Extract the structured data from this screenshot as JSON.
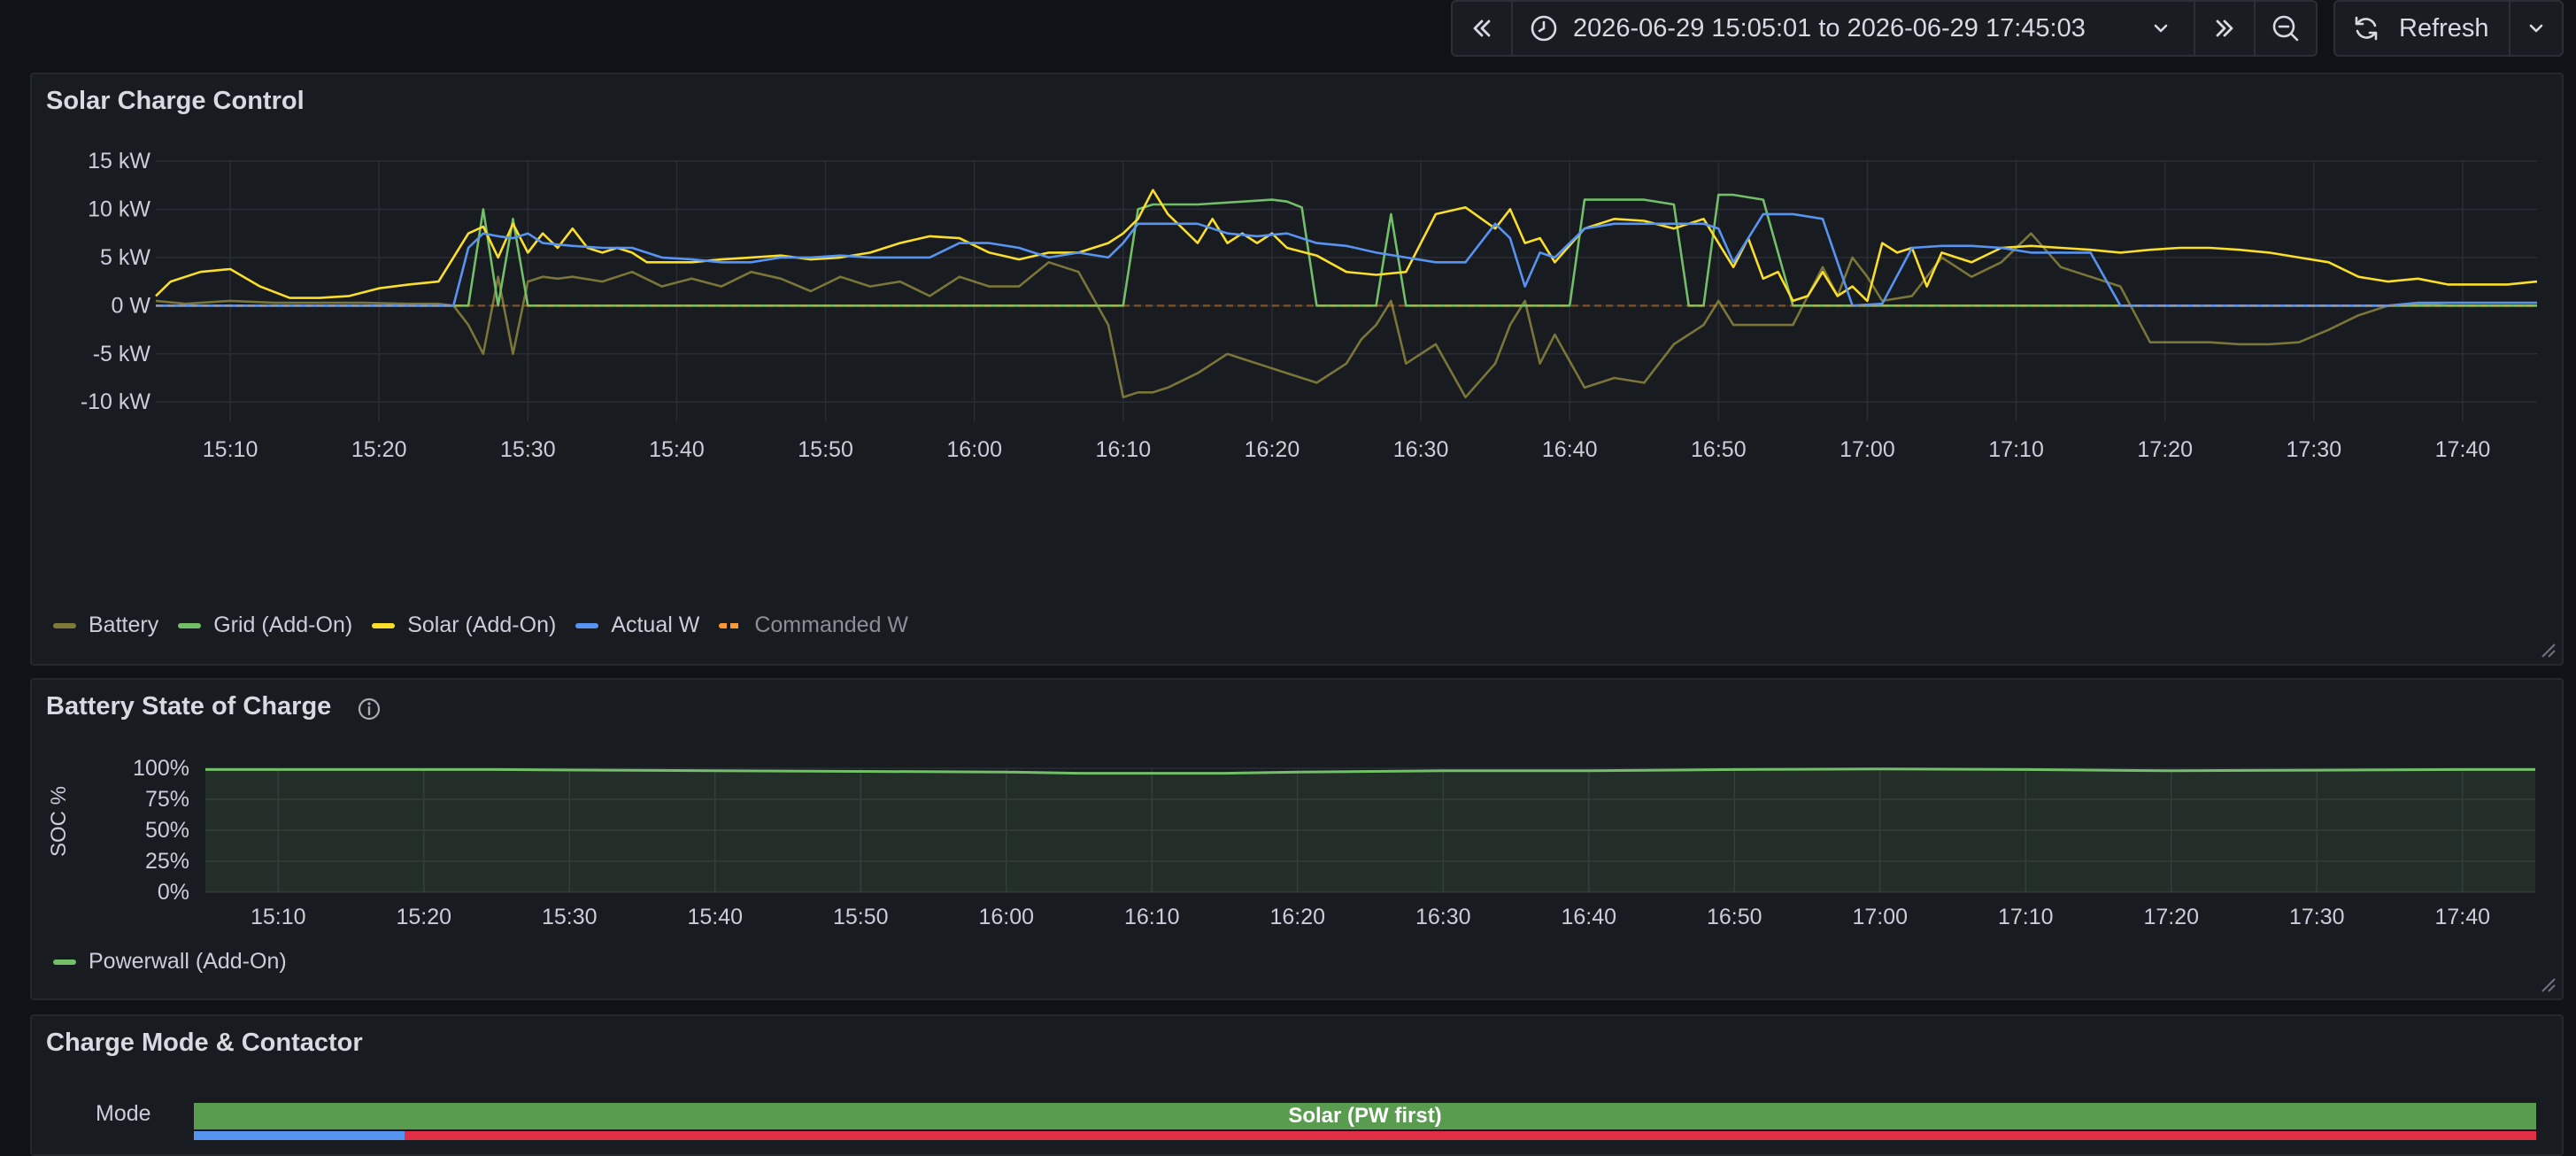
{
  "toolbar": {
    "time_range": "2026-06-29 15:05:01 to 2026-06-29 17:45:03",
    "refresh_label": "Refresh"
  },
  "colors": {
    "battery": "#807a3a",
    "grid": "#73bf69",
    "solar": "#fade2a",
    "actual": "#5794f2",
    "commanded": "#ff9830",
    "mode_bar": "#5a9c4f"
  },
  "panels": {
    "solar": {
      "title": "Solar Charge Control",
      "chart_data": {
        "type": "line",
        "y_ticks": [
          "15 kW",
          "10 kW",
          "5 kW",
          "0 W",
          "-5 kW",
          "-10 kW"
        ],
        "ylim": [
          -12,
          15
        ],
        "x_ticks": [
          "15:10",
          "15:20",
          "15:30",
          "15:40",
          "15:50",
          "16:00",
          "16:10",
          "16:20",
          "16:30",
          "16:40",
          "16:50",
          "17:00",
          "17:10",
          "17:20",
          "17:30",
          "17:40"
        ],
        "x_range_minutes": [
          0,
          160
        ],
        "x_tick_minutes": [
          5,
          15,
          25,
          35,
          45,
          55,
          65,
          75,
          85,
          95,
          105,
          115,
          125,
          135,
          145,
          155
        ],
        "legend": [
          {
            "name": "Battery",
            "color": "#807a3a"
          },
          {
            "name": "Grid (Add-On)",
            "color": "#73bf69"
          },
          {
            "name": "Solar (Add-On)",
            "color": "#fade2a"
          },
          {
            "name": "Actual W",
            "color": "#5794f2"
          },
          {
            "name": "Commanded W",
            "color": "#ff9830",
            "dashed": true,
            "dimmed": true
          }
        ],
        "series": [
          {
            "name": "Solar (Add-On)",
            "t": [
              0,
              1,
              3,
              5,
              7,
              9,
              11,
              13,
              15,
              17,
              19,
              21,
              22,
              23,
              24,
              25,
              26,
              27,
              28,
              29,
              30,
              31,
              32,
              33,
              34,
              36,
              38,
              40,
              42,
              44,
              46,
              48,
              50,
              52,
              54,
              56,
              58,
              60,
              62,
              64,
              65,
              66,
              67,
              68,
              69,
              70,
              71,
              72,
              73,
              74,
              75,
              76,
              78,
              80,
              82,
              84,
              86,
              88,
              90,
              91,
              92,
              93,
              94,
              96,
              98,
              100,
              102,
              104,
              105,
              106,
              107,
              108,
              109,
              110,
              111,
              112,
              113,
              114,
              115,
              116,
              117,
              118,
              119,
              120,
              121,
              122,
              124,
              126,
              128,
              130,
              132,
              134,
              136,
              138,
              140,
              142,
              144,
              146,
              148,
              150,
              152,
              154,
              156,
              158,
              160
            ],
            "v": [
              1,
              2.5,
              3.5,
              3.8,
              2,
              0.8,
              0.8,
              1,
              1.8,
              2.2,
              2.5,
              7.5,
              8.2,
              5,
              8.5,
              5.5,
              7.5,
              6,
              8,
              6,
              5.5,
              6,
              5.5,
              4.5,
              4.5,
              4.5,
              4.8,
              5,
              5.2,
              4.8,
              5,
              5.5,
              6.5,
              7.2,
              7,
              5.5,
              4.8,
              5.5,
              5.5,
              6.5,
              7.5,
              9,
              12,
              9.5,
              8,
              6.5,
              9,
              6.5,
              7.5,
              6.5,
              7.5,
              6,
              5.2,
              3.5,
              3.2,
              3.5,
              9.5,
              10.2,
              8,
              10,
              6.5,
              7,
              4.5,
              8,
              9,
              8.8,
              8,
              9,
              6.5,
              4,
              7,
              2.8,
              3.5,
              0.5,
              1,
              3.5,
              1,
              2,
              0.5,
              6.5,
              5.5,
              6,
              2,
              5.5,
              5,
              4.5,
              6,
              6.2,
              6,
              5.8,
              5.5,
              5.8,
              6,
              6,
              5.8,
              5.5,
              5,
              4.5,
              3,
              2.5,
              2.8,
              2.2,
              2.2,
              2.2,
              2.5
            ]
          },
          {
            "name": "Actual W",
            "t": [
              0,
              20,
              21,
              22,
              23,
              24,
              25,
              26,
              28,
              30,
              32,
              34,
              36,
              38,
              40,
              42,
              44,
              46,
              48,
              50,
              52,
              54,
              56,
              58,
              60,
              62,
              64,
              65,
              66,
              68,
              70,
              72,
              74,
              76,
              78,
              80,
              82,
              84,
              86,
              88,
              90,
              91,
              92,
              93,
              94,
              96,
              98,
              100,
              102,
              104,
              105,
              106,
              108,
              110,
              112,
              114,
              116,
              118,
              120,
              122,
              124,
              126,
              128,
              130,
              132,
              134,
              136,
              138,
              140,
              142,
              144,
              146,
              148,
              150,
              152,
              154,
              156,
              158,
              160
            ],
            "v": [
              0,
              0,
              6,
              7.5,
              7.2,
              7,
              7.5,
              6.5,
              6.2,
              6,
              6,
              5,
              4.8,
              4.5,
              4.5,
              5,
              5,
              5.2,
              5,
              5,
              5,
              6.5,
              6.5,
              6,
              5,
              5.5,
              5,
              6.5,
              8.5,
              8.5,
              8.5,
              7.5,
              7.2,
              7.5,
              6.5,
              6.2,
              5.5,
              5,
              4.5,
              4.5,
              8.5,
              7,
              2,
              5.5,
              5,
              8,
              8.5,
              8.5,
              8.5,
              8.5,
              8,
              4.5,
              9.5,
              9.5,
              9,
              0,
              0.2,
              6,
              6.2,
              6.2,
              6,
              5.5,
              5.5,
              5.5,
              0,
              0,
              0,
              0,
              0,
              0,
              0,
              0,
              0,
              0,
              0.3,
              0.3,
              0.3,
              0.3,
              0.3
            ]
          },
          {
            "name": "Grid (Add-On)",
            "t": [
              0,
              5,
              10,
              15,
              19,
              20,
              21,
              22,
              23,
              24,
              25,
              26,
              27,
              28,
              30,
              35,
              40,
              45,
              50,
              55,
              60,
              64,
              65,
              66,
              67,
              70,
              75,
              76,
              77,
              78,
              80,
              82,
              83,
              84,
              85,
              86,
              88,
              90,
              92,
              93,
              94,
              95,
              96,
              98,
              100,
              102,
              103,
              104,
              105,
              106,
              108,
              110,
              112,
              113,
              114,
              115,
              116,
              118,
              120,
              122,
              124,
              126,
              128,
              130,
              132,
              134,
              136,
              138,
              140,
              142,
              144,
              146,
              148,
              150,
              152,
              154,
              156,
              158,
              160
            ],
            "v": [
              0,
              0,
              0,
              0,
              0,
              0,
              0,
              10,
              0,
              9,
              0,
              0,
              0,
              0,
              0,
              0,
              0,
              0,
              0,
              0,
              0,
              0,
              0,
              10,
              10.5,
              10.5,
              11,
              10.8,
              10.2,
              0,
              0,
              0,
              9.5,
              0,
              0,
              0,
              0,
              0,
              0,
              0,
              0,
              0,
              11,
              11,
              11,
              10.5,
              0,
              0,
              11.5,
              11.5,
              11,
              0,
              0,
              0,
              0,
              0,
              0,
              0,
              0,
              0,
              0,
              0,
              0,
              0,
              0,
              0,
              0,
              0,
              0,
              0,
              0,
              0,
              0,
              0,
              0,
              0,
              0,
              0,
              0
            ]
          },
          {
            "name": "Battery",
            "t": [
              0,
              2,
              5,
              8,
              11,
              14,
              17,
              19,
              20,
              21,
              22,
              23,
              24,
              25,
              26,
              27,
              28,
              30,
              32,
              34,
              36,
              38,
              40,
              42,
              44,
              46,
              48,
              50,
              52,
              54,
              56,
              58,
              60,
              62,
              64,
              65,
              66,
              67,
              68,
              70,
              72,
              74,
              76,
              78,
              80,
              81,
              82,
              83,
              84,
              86,
              88,
              90,
              91,
              92,
              93,
              94,
              96,
              98,
              100,
              102,
              104,
              105,
              106,
              108,
              110,
              112,
              113,
              114,
              115,
              116,
              118,
              120,
              122,
              124,
              126,
              128,
              130,
              132,
              134,
              136,
              138,
              140,
              142,
              144,
              146,
              148,
              150,
              152,
              154,
              156,
              158,
              160
            ],
            "v": [
              0.5,
              0.2,
              0.5,
              0.3,
              0.3,
              0.3,
              0.2,
              0.2,
              0,
              -2,
              -5,
              3,
              -5,
              2.5,
              3,
              2.8,
              3,
              2.5,
              3.5,
              2,
              2.8,
              2,
              3.5,
              2.8,
              1.5,
              3,
              2,
              2.5,
              1,
              3,
              2,
              2,
              4.5,
              3.5,
              -2,
              -9.5,
              -9,
              -9,
              -8.5,
              -7,
              -5,
              -6,
              -7,
              -8,
              -6,
              -3.5,
              -2,
              0.5,
              -6,
              -4,
              -9.5,
              -6,
              -2,
              0.5,
              -6,
              -3,
              -8.5,
              -7.5,
              -8,
              -4,
              -2,
              0.5,
              -2,
              -2,
              -2,
              4,
              1,
              5,
              3,
              0.5,
              1,
              5,
              3,
              4.5,
              7.5,
              4,
              3,
              2,
              -3.8,
              -3.8,
              -3.8,
              -4,
              -4,
              -3.8,
              -2.5,
              -1,
              0,
              0.2,
              0,
              0,
              0,
              0
            ]
          },
          {
            "name": "Commanded W",
            "t": [
              0,
              160
            ],
            "v": [
              0,
              0
            ]
          }
        ]
      }
    },
    "soc": {
      "title": "Battery State of Charge",
      "chart_data": {
        "type": "area",
        "ylabel": "SOC %",
        "y_ticks": [
          "100%",
          "75%",
          "50%",
          "25%",
          "0%"
        ],
        "ylim": [
          0,
          100
        ],
        "x_ticks": [
          "15:10",
          "15:20",
          "15:30",
          "15:40",
          "15:50",
          "16:00",
          "16:10",
          "16:20",
          "16:30",
          "16:40",
          "16:50",
          "17:00",
          "17:10",
          "17:20",
          "17:30",
          "17:40"
        ],
        "x_range_minutes": [
          0,
          160
        ],
        "x_tick_minutes": [
          5,
          15,
          25,
          35,
          45,
          55,
          65,
          75,
          85,
          95,
          105,
          115,
          125,
          135,
          145,
          155
        ],
        "legend": [
          {
            "name": "Powerwall (Add-On)",
            "color": "#73bf69"
          }
        ],
        "series": [
          {
            "name": "Powerwall (Add-On)",
            "t": [
              0,
              20,
              35,
              45,
              55,
              60,
              70,
              75,
              85,
              95,
              105,
              115,
              125,
              135,
              145,
              155,
              160
            ],
            "v": [
              99,
              99,
              98,
              97.5,
              97,
              96,
              96,
              97,
              98,
              98,
              99,
              99.5,
              99,
              98,
              98.5,
              99,
              99
            ]
          }
        ]
      }
    },
    "mode": {
      "title": "Charge Mode & Contactor",
      "row_label": "Mode",
      "mode_value": "Solar (PW first)"
    }
  }
}
